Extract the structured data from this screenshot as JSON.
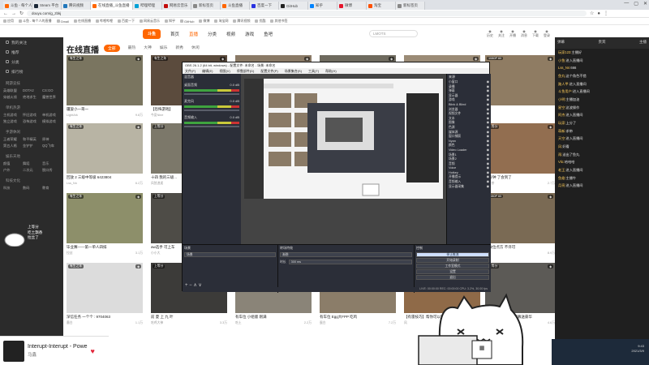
{
  "browser": {
    "tabs": [
      {
        "label": "斗鱼 - 每个人的直播平台",
        "color": "#f60"
      },
      {
        "label": "Steam 平台",
        "color": "#1b2838"
      },
      {
        "label": "腾讯视频",
        "color": "#27b"
      },
      {
        "label": "在线直播_斗鱼直播",
        "color": "#f60"
      },
      {
        "label": "哔哩哔哩",
        "color": "#00a1d6"
      },
      {
        "label": "网易云音乐",
        "color": "#c20c0c"
      },
      {
        "label": "新标签页",
        "color": "#888"
      },
      {
        "label": "斗鱼直播",
        "color": "#f60"
      },
      {
        "label": "百度一下",
        "color": "#2932e1"
      },
      {
        "label": "GitHub",
        "color": "#222"
      },
      {
        "label": "知乎",
        "color": "#0084ff"
      },
      {
        "label": "微博",
        "color": "#e6162d"
      },
      {
        "label": "淘宝",
        "color": "#ff5000"
      },
      {
        "label": "新标签页",
        "color": "#888"
      }
    ],
    "url": "douyu.com/g_zbkj",
    "bookmarks": [
      "应用",
      "斗鱼 - 每个人的直播",
      "Gmail",
      "在线直播",
      "哔哩哔哩",
      "百度一下",
      "网易云音乐",
      "知乎",
      "GitHub",
      "微博",
      "淘宝网",
      "腾讯视频",
      "优酷",
      "其他书签"
    ],
    "window_controls": [
      "—",
      "▢",
      "✕"
    ]
  },
  "site": {
    "logo": "斗鱼",
    "nav": [
      "首页",
      "直播",
      "分类",
      "视频",
      "游戏",
      "鱼吧"
    ],
    "active_nav": "直播",
    "search_placeholder": "LMOTS",
    "header_icons": [
      "历史",
      "关注",
      "开播",
      "消息",
      "下载",
      "登录"
    ]
  },
  "sidebar": {
    "items": [
      "我的关注",
      "推荐",
      "分类",
      "排行榜"
    ],
    "sections": [
      {
        "title": "网游竞技",
        "games": [
          "英雄联盟",
          "DOTA2",
          "CS:GO",
          "穿越火线",
          "绝地求生",
          "魔兽世界"
        ]
      },
      {
        "title": "单机热游",
        "games": [
          "主机游戏",
          "怀旧游戏",
          "单机游戏",
          "独立游戏",
          "恐怖游戏",
          "模拟游戏"
        ]
      },
      {
        "title": "手游休闲",
        "games": [
          "王者荣耀",
          "和平精英",
          "原神",
          "第五人格",
          "金铲铲",
          "QQ飞车"
        ]
      },
      {
        "title": "娱乐天地",
        "games": [
          "颜值",
          "舞蹈",
          "音乐",
          "户外",
          "二次元",
          "脱口秀"
        ]
      },
      {
        "title": "科技文化",
        "games": [
          "科技",
          "数码",
          "教育"
        ]
      }
    ]
  },
  "main": {
    "title": "在线直播",
    "filters": [
      "全部",
      "最热",
      "大神",
      "娱乐",
      "新秀",
      "休闲"
    ],
    "active_filter": "全部",
    "cards": [
      {
        "title": "疆旋小一哥一",
        "streamer": "LightArk",
        "viewers": "9.8万",
        "tag": "有生之年",
        "color": "#7a7560"
      },
      {
        "title": "【恐怖游戏】",
        "streamer": "今夏Nine",
        "viewers": "1.2万",
        "tag": "有生之年",
        "color": "#5b4b3d"
      },
      {
        "title": "",
        "streamer": "",
        "viewers": "",
        "tag": "",
        "color": "#8a7a66"
      },
      {
        "title": "",
        "streamer": "",
        "viewers": "",
        "tag": "",
        "color": "#6e6a5e"
      },
      {
        "title": "",
        "streamer": "",
        "viewers": "",
        "tag": "",
        "color": "#9b8b76"
      },
      {
        "title": "",
        "streamer": "",
        "viewers": "",
        "tag": "1080P 60",
        "color": "#8f7c63"
      },
      {
        "title": "回放 2 三级中等级 6423804",
        "streamer": "Lss_Nn",
        "viewers": "6.2万",
        "tag": "有生之年",
        "color": "#b8b4a4"
      },
      {
        "title": "十四 我的三级...",
        "streamer": "风弦逍遥",
        "viewers": "4.5万",
        "tag": "上等分",
        "color": "#7c786a"
      },
      {
        "title": "",
        "streamer": "",
        "viewers": "",
        "tag": "",
        "color": "#8f8470"
      },
      {
        "title": "",
        "streamer": "",
        "viewers": "",
        "tag": "",
        "color": "#a39784"
      },
      {
        "title": "",
        "streamer": "",
        "viewers": "",
        "tag": "",
        "color": "#6d6454"
      },
      {
        "title": "一分钟 了会到了",
        "streamer": "清雅茶",
        "viewers": "2.7万",
        "tag": "上等分",
        "color": "#926e50"
      },
      {
        "title": "毕业赛——第一单人四排",
        "streamer": "拉丝",
        "viewers": "3.1万",
        "tag": "有生之年",
        "color": "#8d8f6a"
      },
      {
        "title": "aw选手 可上车",
        "streamer": "小小大",
        "viewers": "1.6万",
        "tag": "上等分",
        "color": "#4e4c47"
      },
      {
        "title": "",
        "streamer": "",
        "viewers": "",
        "tag": "",
        "color": "#777"
      },
      {
        "title": "",
        "streamer": "",
        "viewers": "",
        "tag": "",
        "color": "#aaa"
      },
      {
        "title": "",
        "streamer": "",
        "viewers": "",
        "tag": "",
        "color": "#999"
      },
      {
        "title": "满攻位点方 不许可",
        "streamer": "Mmi",
        "viewers": "8.9万",
        "tag": "1080P 60",
        "color": "#7a6a54"
      },
      {
        "title": "深信任务 一个个 : 9704063",
        "streamer": "墨白",
        "viewers": "1.1万",
        "tag": "有生之年",
        "color": "#dcdcdc"
      },
      {
        "title": "前 夏 上 九 叶",
        "streamer": "吃鸡大神",
        "viewers": "3.3万",
        "tag": "上等分",
        "color": "#3c3b39"
      },
      {
        "title": "有车位 小组版 刚满",
        "streamer": "吃土",
        "viewers": "2.2万",
        "tag": "有车位",
        "color": "#8a8478"
      },
      {
        "title": "有车位 Egg大FPP 吃鸡",
        "streamer": "蛋白",
        "viewers": "7.2万",
        "tag": "有车位",
        "color": "#8b7d69"
      },
      {
        "title": "【有雷技巧】帮你可以接触到",
        "streamer": "风",
        "viewers": "1.4万",
        "tag": "1080P 60",
        "color": "#8f6a48"
      },
      {
        "title": "♥自由着团的我们 招募送豪华",
        "streamer": "Vlic赵",
        "viewers": "4.6万",
        "tag": "上等分",
        "color": "#5c5a56"
      }
    ]
  },
  "obs": {
    "title": "OBS 26.1.2 (64 bit, windows) - 配置文件: 未命名 - 场景: 未命名",
    "menu": [
      "文件(F)",
      "编辑(E)",
      "视图(V)",
      "停靠部件(D)",
      "配置文件(P)",
      "场景集合(S)",
      "工具(T)",
      "帮助(H)"
    ],
    "mixer_title": "混音器",
    "mixer_channels": [
      {
        "name": "桌面音频",
        "db": "0.0 dB"
      },
      {
        "name": "麦克风",
        "db": "0.0 dB"
      },
      {
        "name": "音频输入",
        "db": "0.0 dB"
      }
    ],
    "sources_title": "来源",
    "sources": [
      "小窗口",
      "录播",
      "弹幕",
      "显示器",
      "游戏",
      "Blink & Blind",
      "浏览器",
      "视频文件",
      "文本",
      "图像",
      "色源",
      "媒体源",
      "窗口捕获",
      "Nyan",
      "颜色",
      "Video Loader",
      "场景1",
      "场景2",
      "音频",
      "Voice",
      "Hotkey",
      "开播提示",
      "音频输入",
      "显示器采集"
    ],
    "scenes_title": "场景",
    "scenes": [
      "场景"
    ],
    "transitions_title": "转场特效",
    "transition_value": "渐隐",
    "duration_label": "时长",
    "duration_value": "300 ms",
    "controls_title": "控制",
    "controls": [
      "停止推流",
      "开始录制",
      "工作室模式",
      "设置",
      "退出"
    ],
    "status": "LIVE: 00:00:00  REC: 00:00:00  CPU: 3.2%, 30.00 fps"
  },
  "chat": {
    "header": "主播",
    "tabs": [
      "弹幕",
      "贵宾"
    ],
    "messages": [
      {
        "user": "玩家123:",
        "text": "主播好"
      },
      {
        "user": "小鱼:",
        "text": "进入直播间"
      },
      {
        "user": "Lss_Nn:",
        "text": "666"
      },
      {
        "user": "鱼丸:",
        "text": "这个角色不错"
      },
      {
        "user": "路人甲:",
        "text": "进入直播间"
      },
      {
        "user": "斗鱼用户:",
        "text": "进入直播间"
      },
      {
        "user": "小明:",
        "text": "主播加油"
      },
      {
        "user": "星空:",
        "text": "这波操作"
      },
      {
        "user": "阿杰:",
        "text": "进入直播间"
      },
      {
        "user": "玩家:",
        "text": "上分了"
      },
      {
        "user": "萌新:",
        "text": "求带"
      },
      {
        "user": "天空:",
        "text": "进入直播间"
      },
      {
        "user": "风:",
        "text": "好看"
      },
      {
        "user": "雨:",
        "text": "送出了鱼丸"
      },
      {
        "user": "Vlic:",
        "text": "哈哈哈"
      },
      {
        "user": "老王:",
        "text": "进入直播间"
      },
      {
        "user": "鱼翅:",
        "text": "主播牛"
      },
      {
        "user": "月亮:",
        "text": "进入直播间"
      }
    ]
  },
  "player": {
    "title": "Interupt-Interupt - Powe",
    "artist": "马鑫"
  },
  "taskbar": {
    "time": "9:43",
    "date": "2021/3/9"
  },
  "sticker": {
    "line1": "上等分",
    "line2": "吃土飘香",
    "line3": "拉丝了"
  },
  "colors": {
    "accent": "#ff6600",
    "obs_bg": "#2b2e38",
    "chat_bg": "#1f1f1f",
    "sidebar_bg": "#2b2b2b"
  }
}
